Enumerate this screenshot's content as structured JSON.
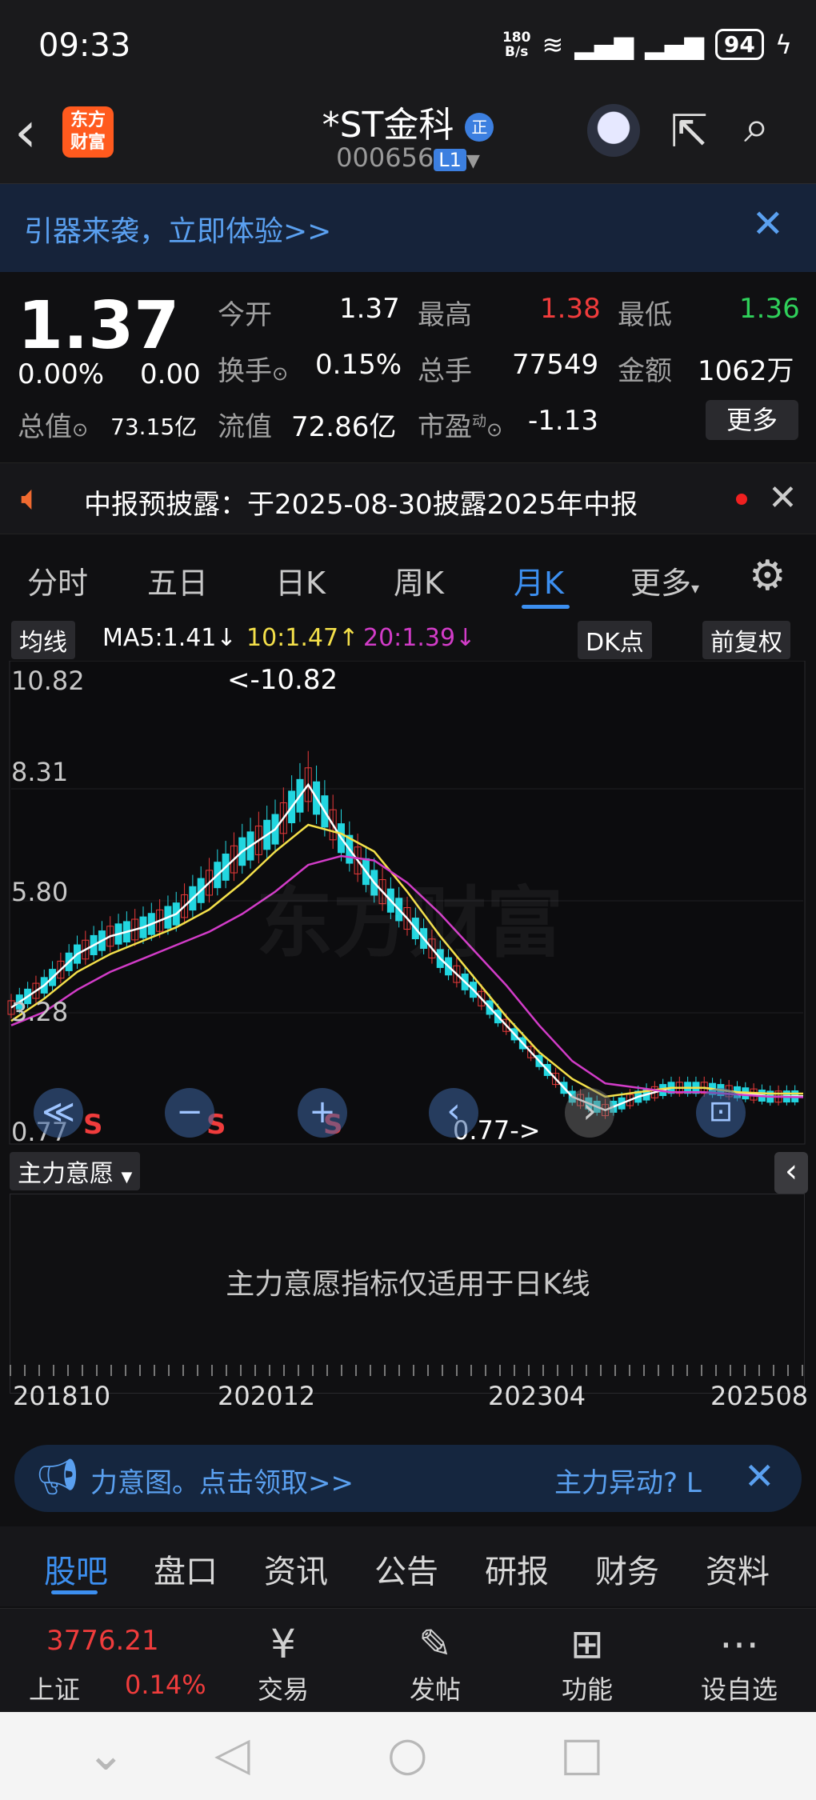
{
  "status_bar": {
    "time": "09:33",
    "net_speed_top": "180",
    "net_speed_bottom": "B/s",
    "battery": "94"
  },
  "header": {
    "back_glyph": "‹",
    "logo_text_1": "东方",
    "logo_text_2": "财富",
    "title": "*ST金科",
    "badge": "正",
    "code": "000656",
    "level": "L1"
  },
  "banner": {
    "text": "引器来袭，立即体验>>",
    "close": "✕"
  },
  "quote": {
    "price": "1.37",
    "change_pct": "0.00%",
    "change": "0.00",
    "row1": [
      {
        "label": "今开",
        "value": "1.37"
      },
      {
        "label": "最高",
        "value": "1.38"
      },
      {
        "label": "最低",
        "value": "1.36"
      }
    ],
    "row2": [
      {
        "label": "换手",
        "value": "0.15%"
      },
      {
        "label": "总手",
        "value": "77549"
      },
      {
        "label": "金额",
        "value": "1062万"
      }
    ],
    "row3": [
      {
        "label": "总值",
        "value": "73.15亿"
      },
      {
        "label": "流值",
        "value": "72.86亿"
      },
      {
        "label": "市盈",
        "superscript": "动",
        "value": "-1.13"
      }
    ],
    "more": "更多",
    "colors": {
      "up": "#f03c3c",
      "down": "#2fd05a"
    }
  },
  "notice": {
    "text": "中报预披露：于2025-08-30披露2025年中报",
    "close": "✕"
  },
  "tabs": [
    "分时",
    "五日",
    "日K",
    "周K",
    "月K",
    "更多"
  ],
  "active_tab": "月K",
  "ma_bar": {
    "indicator": "均线",
    "ma5": "MA5:1.41",
    "ma5_arrow": "↓",
    "ma10": "10:1.47",
    "ma10_arrow": "↑",
    "ma20": "20:1.39",
    "ma20_arrow": "↓",
    "dk": "DK点",
    "adjust": "前复权",
    "colors": {
      "ma5": "#ffffff",
      "ma10": "#f4e04a",
      "ma20": "#d23cc8"
    }
  },
  "chart_data": {
    "type": "candlestick",
    "y_ticks": [
      "10.82",
      "8.31",
      "5.80",
      "3.28",
      "0.77"
    ],
    "ylim": [
      0.77,
      10.82
    ],
    "max_label": "<-10.82",
    "min_label": "0.77->",
    "x_ticks": [
      "201810",
      "202012",
      "202304",
      "202508"
    ],
    "watermark": "东方财富",
    "series": [
      {
        "name": "MA5",
        "values": [
          3.4,
          3.9,
          4.6,
          5.0,
          5.2,
          5.5,
          6.2,
          6.9,
          7.4,
          8.4,
          7.2,
          6.2,
          5.4,
          4.5,
          3.8,
          3.0,
          2.2,
          1.4,
          1.1,
          1.4,
          1.6,
          1.6,
          1.5,
          1.4,
          1.41
        ]
      },
      {
        "name": "10",
        "values": [
          3.1,
          3.6,
          4.2,
          4.6,
          4.9,
          5.2,
          5.6,
          6.2,
          6.9,
          7.5,
          7.3,
          6.9,
          6.0,
          5.0,
          4.1,
          3.2,
          2.4,
          1.8,
          1.4,
          1.5,
          1.6,
          1.6,
          1.5,
          1.47,
          1.47
        ]
      },
      {
        "name": "20",
        "values": [
          3.0,
          3.3,
          3.8,
          4.2,
          4.5,
          4.8,
          5.1,
          5.5,
          6.0,
          6.6,
          6.8,
          6.7,
          6.2,
          5.5,
          4.7,
          3.9,
          3.0,
          2.2,
          1.7,
          1.6,
          1.5,
          1.5,
          1.45,
          1.4,
          1.39
        ]
      }
    ],
    "markers": [
      "S",
      "S",
      "S"
    ]
  },
  "chart_controls": [
    "≪",
    "−",
    "+",
    "‹",
    "›",
    "⊡"
  ],
  "zhuli": {
    "label": "主力意愿",
    "message": "主力意愿指标仅适用于日K线",
    "collapse": "‹"
  },
  "promo": {
    "left": "力意图。点击领取>>",
    "right": "主力异动? L",
    "close": "✕"
  },
  "section_tabs": [
    "股吧",
    "盘口",
    "资讯",
    "公告",
    "研报",
    "财务",
    "资料"
  ],
  "active_section": "股吧",
  "bottom_nav": {
    "index_value": "3776.21",
    "index_name": "上证",
    "index_pct": "0.14%",
    "items": [
      {
        "label": "交易",
        "icon": "¥"
      },
      {
        "label": "发帖",
        "icon": "✎"
      },
      {
        "label": "功能",
        "icon": "⊞"
      },
      {
        "label": "设自选",
        "icon": "⋯"
      }
    ]
  },
  "android_nav": [
    "⌄",
    "◁",
    "○",
    "□"
  ]
}
